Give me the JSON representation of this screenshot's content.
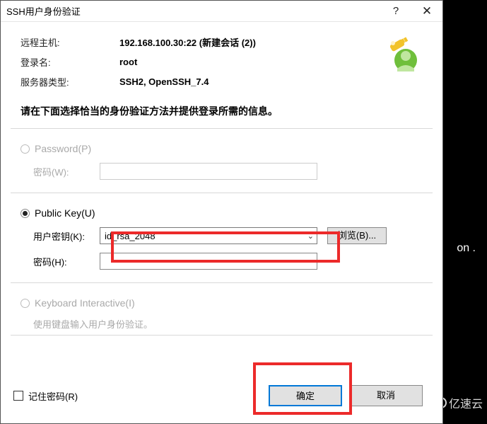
{
  "title": "SSH用户身份验证",
  "info": {
    "remoteHostLabel": "远程主机:",
    "remoteHostValue": "192.168.100.30:22 (新建会话 (2))",
    "loginLabel": "登录名:",
    "loginValue": "root",
    "serverTypeLabel": "服务器类型:",
    "serverTypeValue": "SSH2, OpenSSH_7.4"
  },
  "instruction": "请在下面选择恰当的身份验证方法并提供登录所需的信息。",
  "methods": {
    "password": {
      "label": "Password(P)",
      "pwdLabel": "密码(W):"
    },
    "publicKey": {
      "label": "Public Key(U)",
      "userKeyLabel": "用户密钥(K):",
      "keyValue": "id_rsa_2048",
      "browse": "浏览(B)...",
      "pwdLabel": "密码(H):"
    },
    "keyboard": {
      "label": "Keyboard Interactive(I)",
      "hint": "使用键盘输入用户身份验证。"
    }
  },
  "footer": {
    "remember": "记住密码(R)",
    "ok": "确定",
    "cancel": "取消"
  },
  "background": {
    "fragment": "on .",
    "watermark": "亿速云"
  }
}
